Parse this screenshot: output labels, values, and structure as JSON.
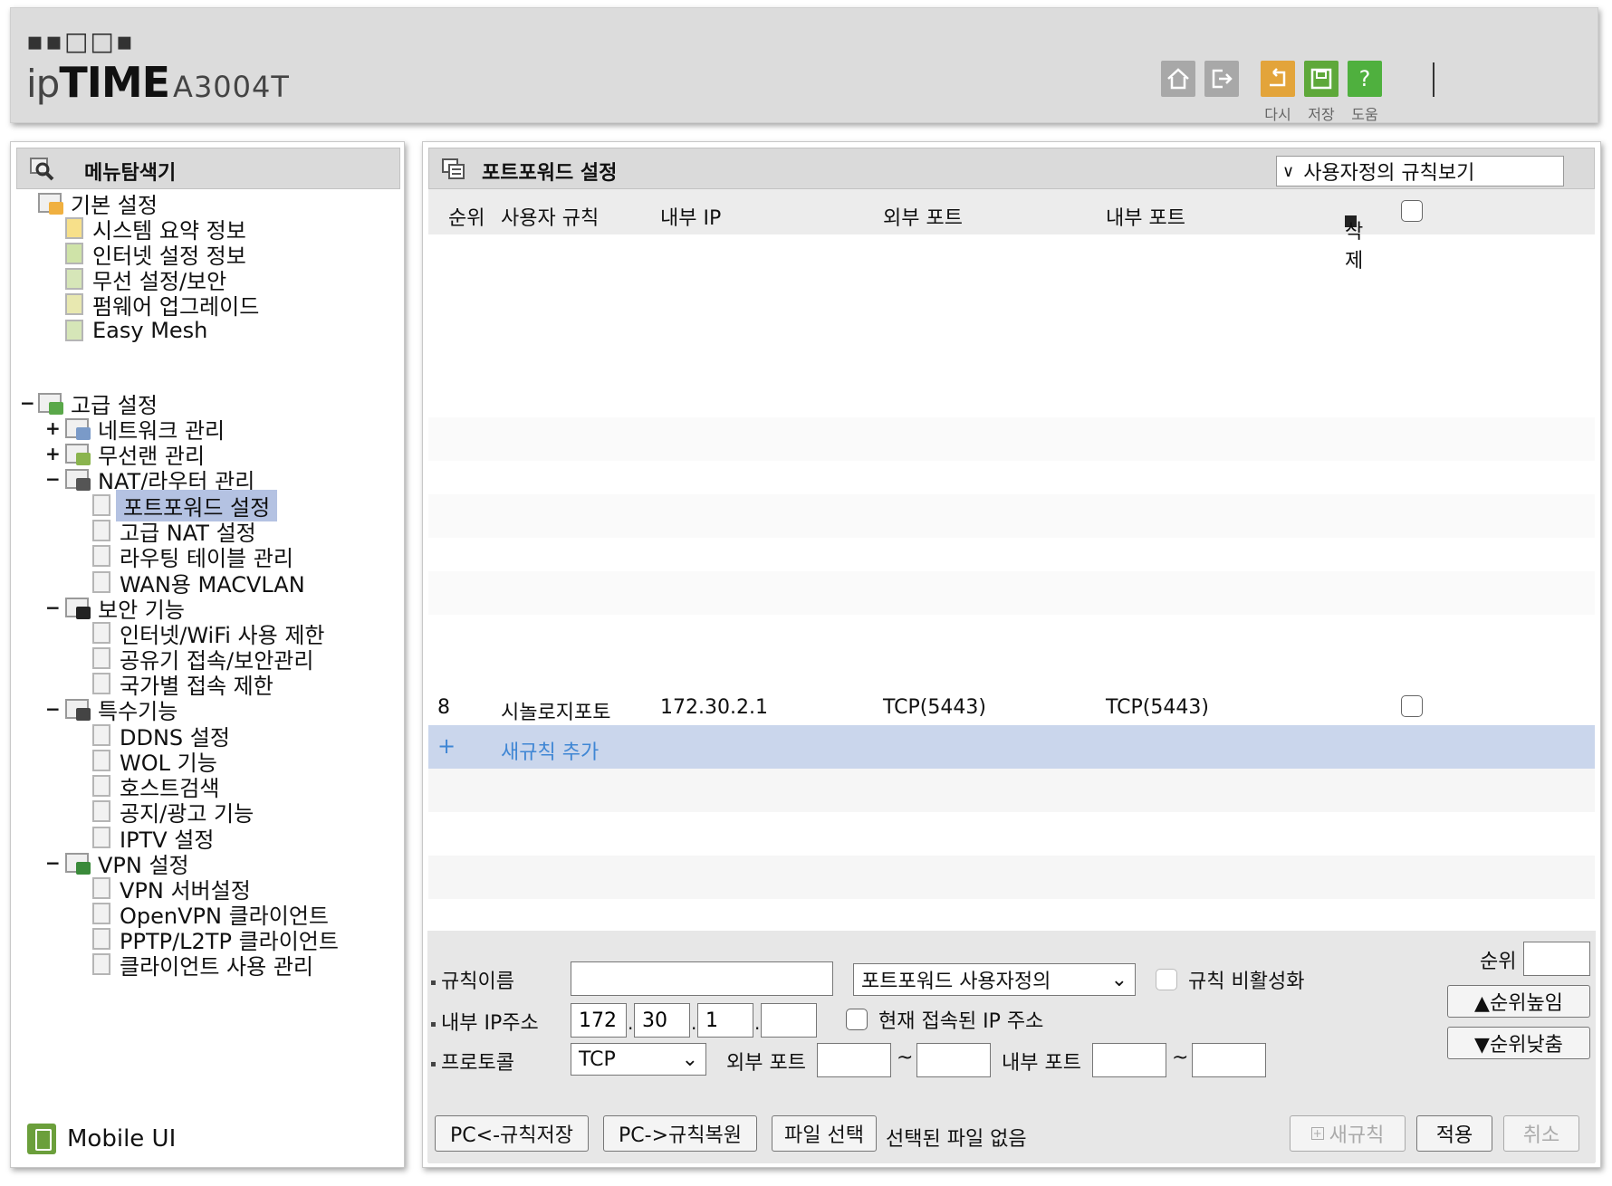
{
  "header": {
    "logo_mark": "▪▪□□▪",
    "logo_ip": "ip",
    "logo_time": "TIME",
    "model": "A3004T",
    "buttons": [
      {
        "name": "home",
        "label": ""
      },
      {
        "name": "logout",
        "label": ""
      },
      {
        "name": "reload",
        "label": "다시"
      },
      {
        "name": "save",
        "label": "저장"
      },
      {
        "name": "help",
        "label": "도움"
      }
    ]
  },
  "sidebar": {
    "title": "메뉴탐색기",
    "basic": {
      "label": "기본 설정",
      "items": [
        "시스템 요약 정보",
        "인터넷 설정 정보",
        "무선 설정/보안",
        "펌웨어 업그레이드",
        "Easy Mesh"
      ]
    },
    "advanced": {
      "toggle": "−",
      "label": "고급 설정",
      "groups": [
        {
          "toggle": "+",
          "label": "네트워크 관리"
        },
        {
          "toggle": "+",
          "label": "무선랜 관리"
        },
        {
          "toggle": "−",
          "label": "NAT/라우터 관리"
        },
        {
          "toggle": "−",
          "label": "보안 기능"
        },
        {
          "toggle": "−",
          "label": "특수기능"
        },
        {
          "toggle": "−",
          "label": "VPN 설정"
        }
      ],
      "nat_items": [
        "포트포워드 설정",
        "고급 NAT 설정",
        "라우팅 테이블 관리",
        "WAN용 MACVLAN"
      ],
      "security_items": [
        "인터넷/WiFi 사용 제한",
        "공유기 접속/보안관리",
        "국가별 접속 제한"
      ],
      "special_items": [
        "DDNS 설정",
        "WOL 기능",
        "호스트검색",
        "공지/광고 기능",
        "IPTV 설정"
      ],
      "vpn_items": [
        "VPN 서버설정",
        "OpenVPN 클라이언트",
        "PPTP/L2TP 클라이언트",
        "클라이언트 사용 관리"
      ]
    },
    "mobile_ui": "Mobile UI"
  },
  "main": {
    "title": "포트포워드 설정",
    "view_select": "사용자정의 규칙보기",
    "columns": {
      "order": "순위",
      "rule": "사용자 규칙",
      "internal_ip": "내부 IP",
      "external_port": "외부 포트",
      "internal_port": "내부 포트",
      "delete": "삭제"
    },
    "rows": [
      {
        "order": "8",
        "rule": "시놀로지포토",
        "internal_ip": "172.30.2.1",
        "external_port": "TCP(5443)",
        "internal_port": "TCP(5443)"
      }
    ],
    "new_rule_symbol": "+",
    "new_rule": "새규칙 추가"
  },
  "form": {
    "rule_name_label": "규칙이름",
    "rule_name_value": "",
    "rule_type": "포트포워드 사용자정의",
    "disable_label": "규칙 비활성화",
    "order_label": "순위",
    "order_value": "",
    "raise_label": "▲순위높임",
    "lower_label": "▼순위낮춤",
    "ip_label": "내부 IP주소",
    "ip": [
      "172",
      "30",
      "1",
      ""
    ],
    "current_ip_label": "현재 접속된 IP 주소",
    "protocol_label": "프로토콜",
    "protocol": "TCP",
    "ext_port_label": "외부 포트",
    "int_port_label": "내부 포트",
    "range_sep": "~",
    "ip_sep": ".",
    "ports": [
      "",
      "",
      "",
      ""
    ],
    "backup_label": "PC<-규칙저장",
    "restore_label": "PC->규칙복원",
    "file_button": "파일 선택",
    "file_status": "선택된 파일 없음",
    "new_rule_button": "새규칙",
    "apply_button": "적용",
    "cancel_button": "취소"
  },
  "colors": {
    "selected": "#b4c2e2",
    "new_rule_bg": "#cad6ec",
    "link": "#3f86d4",
    "reload": "#e3a43a",
    "save": "#5ea83a",
    "help": "#4fb03e"
  }
}
